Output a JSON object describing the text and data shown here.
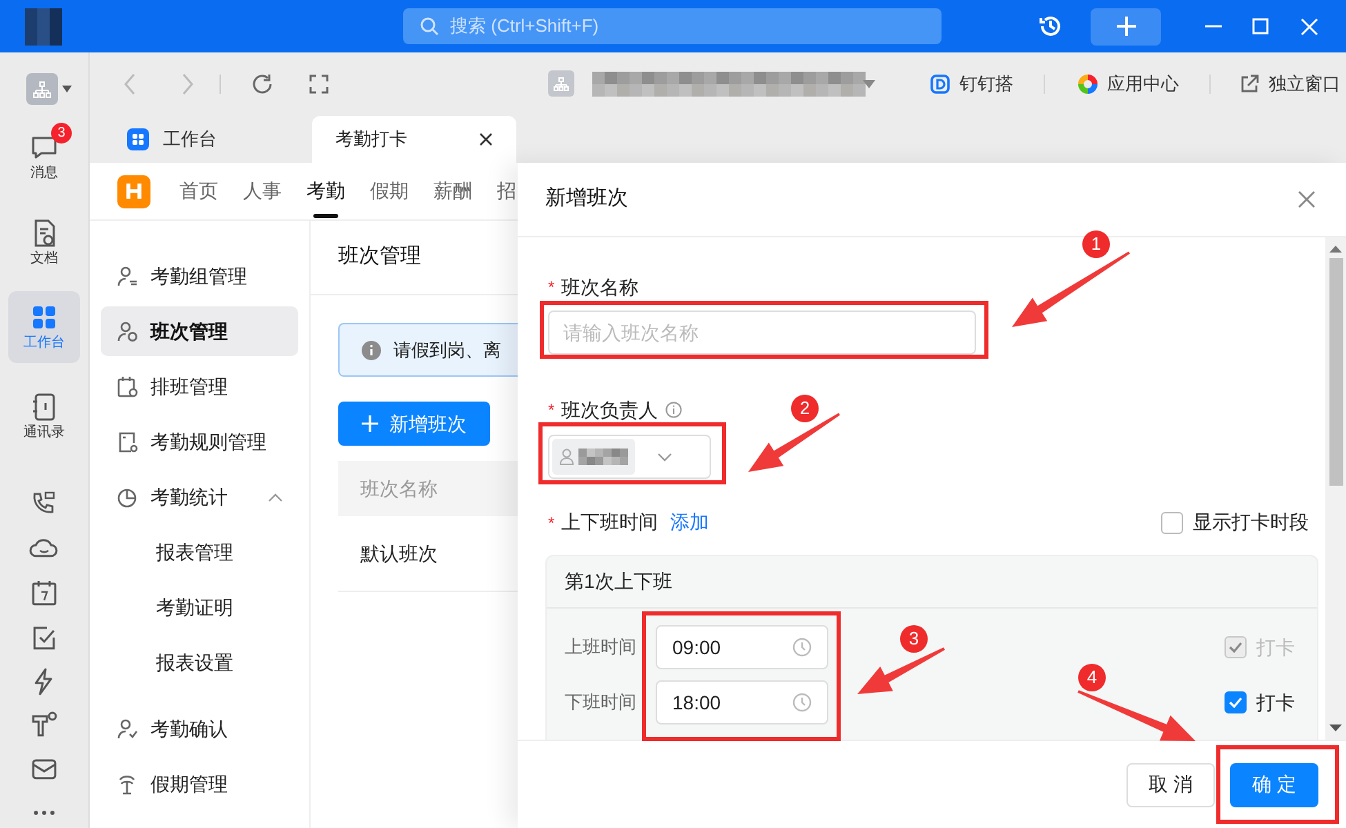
{
  "title_bar": {
    "search_placeholder": "搜索 (Ctrl+Shift+F)"
  },
  "rail": [
    {
      "label": "消息",
      "badge": "3",
      "selected": false
    },
    {
      "label": "文档",
      "selected": false
    },
    {
      "label": "工作台",
      "selected": true
    },
    {
      "label": "通讯录",
      "selected": false
    }
  ],
  "toolbar_links": [
    "钉钉搭",
    "应用中心",
    "独立窗口"
  ],
  "tabs": [
    {
      "label": "工作台",
      "selected": false
    },
    {
      "label": "考勤打卡",
      "selected": true
    }
  ],
  "app_nav": [
    {
      "label": "首页",
      "selected": false
    },
    {
      "label": "人事",
      "selected": false
    },
    {
      "label": "考勤",
      "selected": true
    },
    {
      "label": "假期",
      "selected": false
    },
    {
      "label": "薪酬",
      "selected": false
    },
    {
      "label": "招",
      "selected": false
    }
  ],
  "side_menu": [
    {
      "label": "考勤组管理",
      "selected": false
    },
    {
      "label": "班次管理",
      "selected": true
    },
    {
      "label": "排班管理",
      "selected": false
    },
    {
      "label": "考勤规则管理",
      "selected": false
    },
    {
      "label": "考勤统计",
      "selected": false,
      "expanded": true,
      "children": [
        {
          "label": "报表管理",
          "selected": false
        },
        {
          "label": "考勤证明",
          "selected": false
        },
        {
          "label": "报表设置",
          "selected": false
        }
      ]
    },
    {
      "label": "考勤确认",
      "selected": false
    },
    {
      "label": "假期管理",
      "selected": false
    }
  ],
  "main": {
    "title": "班次管理",
    "notice": "请假到岗、离",
    "add_button": "新增班次",
    "table": {
      "columns": [
        "班次名称"
      ],
      "rows": [
        [
          "默认班次"
        ]
      ]
    }
  },
  "drawer": {
    "title": "新增班次",
    "name_field": {
      "label": "班次名称",
      "required_mark": "*",
      "placeholder": "请输入班次名称"
    },
    "owner_field": {
      "label": "班次负责人",
      "required_mark": "*"
    },
    "time_section": {
      "label": "上下班时间",
      "required_mark": "*",
      "add_link": "添加",
      "show_periods": {
        "label": "显示打卡时段",
        "checked": false
      },
      "groups": [
        {
          "title": "第1次上下班",
          "rows": [
            {
              "label": "上班时间",
              "value": "09:00",
              "punch": {
                "label": "打卡",
                "checked": true,
                "disabled": true
              }
            },
            {
              "label": "下班时间",
              "value": "18:00",
              "punch": {
                "label": "打卡",
                "checked": true,
                "disabled": false
              }
            }
          ]
        }
      ]
    },
    "buttons": [
      {
        "label": "取 消",
        "kind": "secondary"
      },
      {
        "label": "确 定",
        "kind": "primary"
      }
    ]
  },
  "annotations": [
    {
      "number": "1"
    },
    {
      "number": "2"
    },
    {
      "number": "3"
    },
    {
      "number": "4"
    }
  ]
}
